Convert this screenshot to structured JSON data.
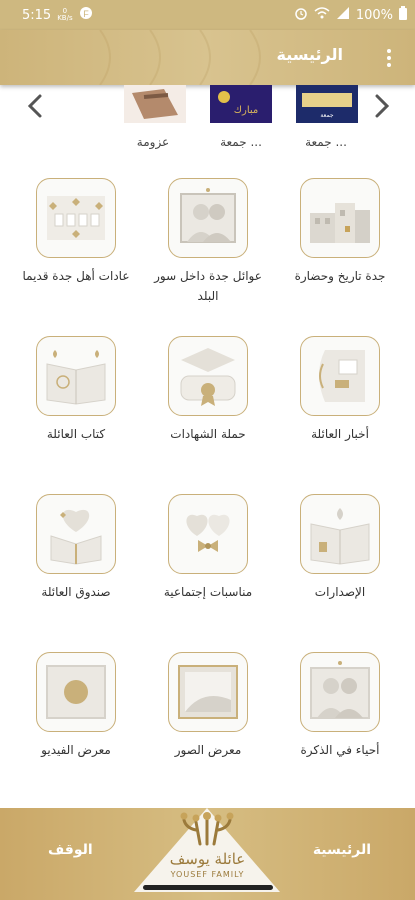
{
  "status_bar": {
    "time": "5:15",
    "net_speed_value": "0",
    "net_speed_unit": "KB/s",
    "battery": "100%"
  },
  "app_bar": {
    "title": "الرئيسية"
  },
  "slider": {
    "labels": [
      "جمعة ...",
      "جمعة ...",
      "عزومة"
    ]
  },
  "tiles": [
    {
      "label": "جدة تاريخ وحضارة",
      "icon": "old-buildings-icon"
    },
    {
      "label": "عوائل جدة داخل سور البلد",
      "icon": "family-portrait-icon"
    },
    {
      "label": "عادات أهل جدة قديما",
      "icon": "traditional-pattern-icon"
    },
    {
      "label": "أخبار العائلة",
      "icon": "map-news-icon"
    },
    {
      "label": "حملة الشهادات",
      "icon": "graduation-certificate-icon"
    },
    {
      "label": "كتاب العائلة",
      "icon": "open-book-icon"
    },
    {
      "label": "الإصدارات",
      "icon": "publications-book-icon"
    },
    {
      "label": "مناسبات إجتماعية",
      "icon": "hearts-bow-icon"
    },
    {
      "label": "صندوق العائلة",
      "icon": "heart-box-icon"
    },
    {
      "label": "أحياء في الذكرة",
      "icon": "memorial-portrait-icon"
    },
    {
      "label": "معرض الصور",
      "icon": "photo-gallery-icon"
    },
    {
      "label": "معرض الفيديو",
      "icon": "video-gallery-icon"
    }
  ],
  "bottom_nav": {
    "home_label": "الرئيسية",
    "waqf_label": "الوقف",
    "logo_ar": "عائلة يوسف",
    "logo_en": "YOUSEF FAMILY"
  },
  "colors": {
    "gold": "#ceb880",
    "gold_dark": "#c9b07a",
    "brown": "#9b7a3b"
  }
}
